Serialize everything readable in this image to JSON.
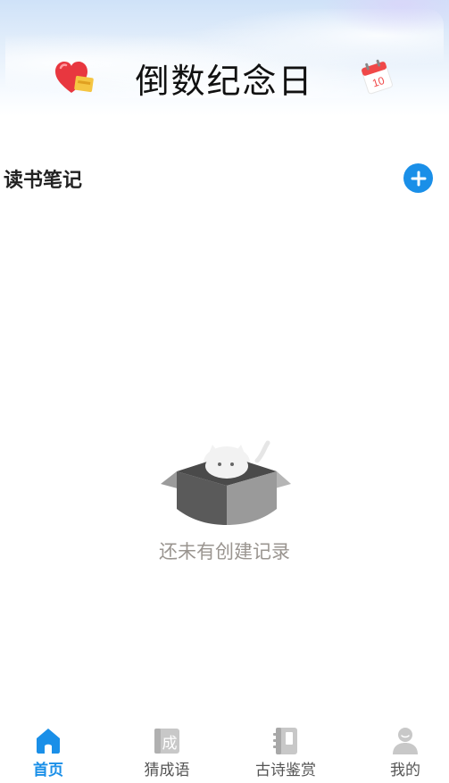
{
  "header": {
    "title": "倒数纪念日"
  },
  "section": {
    "title": "读书笔记",
    "add_icon": "plus-icon"
  },
  "empty_state": {
    "message": "还未有创建记录",
    "illustration": "empty-box-illustration"
  },
  "bottom_nav": {
    "items": [
      {
        "label": "首页",
        "icon": "home-icon",
        "active": true
      },
      {
        "label": "猜成语",
        "icon": "idiom-icon",
        "active": false
      },
      {
        "label": "古诗鉴赏",
        "icon": "book-icon",
        "active": false
      },
      {
        "label": "我的",
        "icon": "user-icon",
        "active": false
      }
    ]
  },
  "colors": {
    "accent": "#1a8fe8",
    "inactive_icon": "#c8c8c8",
    "empty_text": "#9a9590"
  }
}
